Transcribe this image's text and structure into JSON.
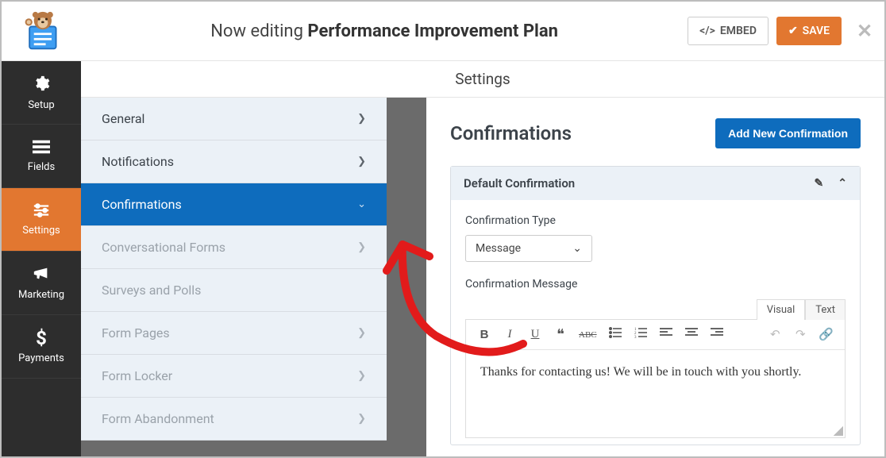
{
  "header": {
    "editing_prefix": "Now editing ",
    "form_name": "Performance Improvement Plan",
    "embed_label": "EMBED",
    "save_label": "SAVE"
  },
  "leftnav": {
    "items": [
      {
        "key": "setup",
        "label": "Setup",
        "icon": "gear"
      },
      {
        "key": "fields",
        "label": "Fields",
        "icon": "list"
      },
      {
        "key": "settings",
        "label": "Settings",
        "icon": "sliders",
        "active": true
      },
      {
        "key": "marketing",
        "label": "Marketing",
        "icon": "bullhorn"
      },
      {
        "key": "payments",
        "label": "Payments",
        "icon": "dollar"
      }
    ]
  },
  "settings_header": "Settings",
  "submenu": {
    "items": [
      {
        "label": "General",
        "state": "normal"
      },
      {
        "label": "Notifications",
        "state": "normal"
      },
      {
        "label": "Confirmations",
        "state": "active"
      },
      {
        "label": "Conversational Forms",
        "state": "disabled"
      },
      {
        "label": "Surveys and Polls",
        "state": "disabled"
      },
      {
        "label": "Form Pages",
        "state": "disabled"
      },
      {
        "label": "Form Locker",
        "state": "disabled"
      },
      {
        "label": "Form Abandonment",
        "state": "disabled"
      }
    ]
  },
  "panel": {
    "title": "Confirmations",
    "add_button": "Add New Confirmation",
    "card_title": "Default Confirmation",
    "type_label": "Confirmation Type",
    "type_value": "Message",
    "message_label": "Confirmation Message",
    "editor_tabs": {
      "visual": "Visual",
      "text": "Text"
    },
    "message_body": "Thanks for contacting us! We will be in touch with you shortly."
  }
}
